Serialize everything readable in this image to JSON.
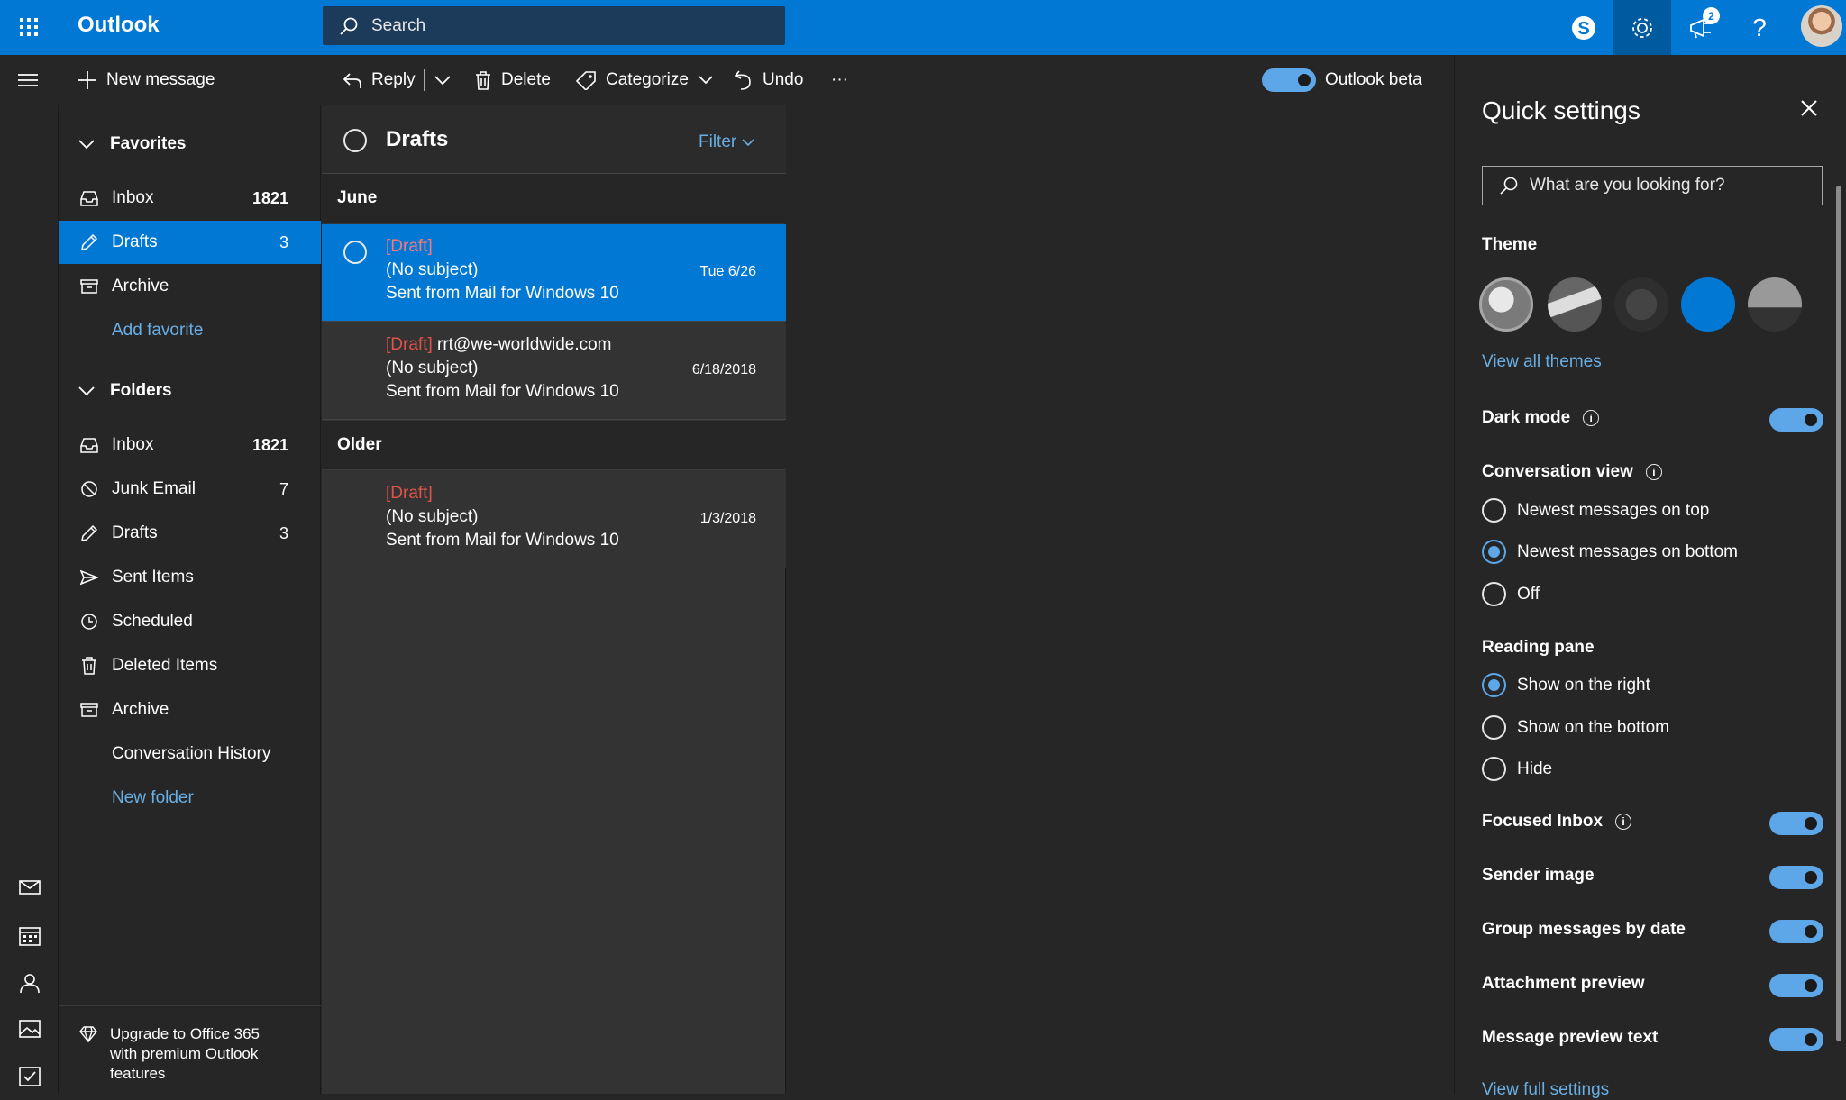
{
  "app": {
    "title": "Outlook"
  },
  "search": {
    "placeholder": "Search"
  },
  "topbar": {
    "notification_count": "2"
  },
  "commands": {
    "new_message": "New message",
    "reply": "Reply",
    "delete": "Delete",
    "categorize": "Categorize",
    "undo": "Undo",
    "more": "···",
    "beta_label": "Outlook beta"
  },
  "favorites": {
    "header": "Favorites",
    "items": [
      {
        "label": "Inbox",
        "count": "1821"
      },
      {
        "label": "Drafts",
        "count": "3"
      },
      {
        "label": "Archive",
        "count": ""
      }
    ],
    "add_link": "Add favorite"
  },
  "folders": {
    "header": "Folders",
    "items": [
      {
        "label": "Inbox",
        "count": "1821"
      },
      {
        "label": "Junk Email",
        "count": "7"
      },
      {
        "label": "Drafts",
        "count": "3"
      },
      {
        "label": "Sent Items",
        "count": ""
      },
      {
        "label": "Scheduled",
        "count": ""
      },
      {
        "label": "Deleted Items",
        "count": ""
      },
      {
        "label": "Archive",
        "count": ""
      },
      {
        "label": "Conversation History",
        "count": ""
      }
    ],
    "new_link": "New folder"
  },
  "upgrade": {
    "text": "Upgrade to Office 365 with premium Outlook features"
  },
  "messagelist": {
    "title": "Drafts",
    "filter": "Filter",
    "groups": [
      {
        "label": "June"
      },
      {
        "label": "Older"
      }
    ],
    "messages": [
      {
        "tag": "[Draft]",
        "to": "",
        "subject": "(No subject)",
        "preview": "Sent from Mail for Windows 10",
        "date": "Tue 6/26"
      },
      {
        "tag": "[Draft]",
        "to": "rrt@we-worldwide.com",
        "subject": "(No subject)",
        "preview": "Sent from Mail for Windows 10",
        "date": "6/18/2018"
      },
      {
        "tag": "[Draft]",
        "to": "",
        "subject": "(No subject)",
        "preview": "Sent from Mail for Windows 10",
        "date": "1/3/2018"
      }
    ]
  },
  "quick_settings": {
    "title": "Quick settings",
    "search_placeholder": "What are you looking for?",
    "theme_label": "Theme",
    "view_all_themes": "View all themes",
    "dark_mode": "Dark mode",
    "conversation_view": "Conversation view",
    "conv_options": [
      "Newest messages on top",
      "Newest messages on bottom",
      "Off"
    ],
    "reading_pane": "Reading pane",
    "reading_options": [
      "Show on the right",
      "Show on the bottom",
      "Hide"
    ],
    "focused_inbox": "Focused Inbox",
    "sender_image": "Sender image",
    "group_by_date": "Group messages by date",
    "attachment_preview": "Attachment preview",
    "message_preview_text": "Message preview text",
    "view_full_settings": "View full settings"
  },
  "colors": {
    "accent": "#0078d4",
    "link": "#69afe5",
    "draft": "#e0524a"
  }
}
